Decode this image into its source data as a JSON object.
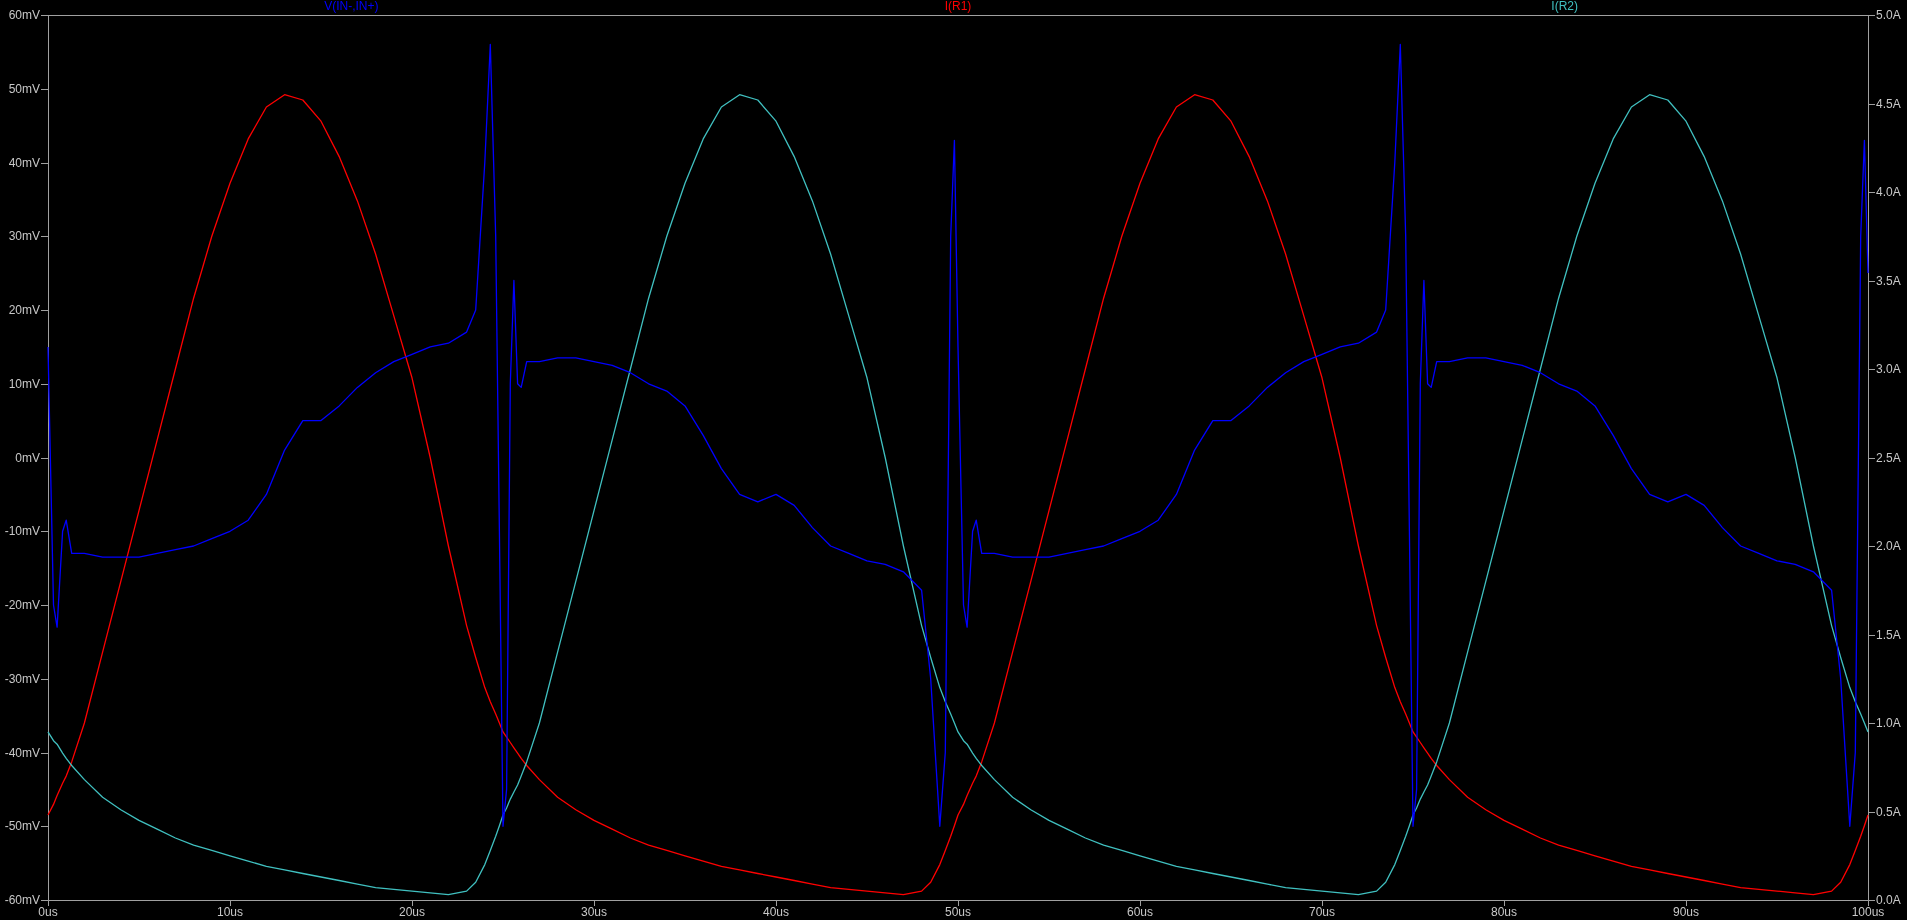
{
  "chart_data": {
    "type": "line",
    "x": [
      0,
      0.3,
      0.5,
      0.8,
      1,
      1.3,
      2,
      3,
      4,
      5,
      6,
      7,
      8,
      9,
      10,
      11,
      12,
      13,
      14,
      15,
      16,
      17,
      18,
      19,
      20,
      21,
      22,
      23,
      23.5,
      24,
      24.3,
      24.6,
      24.8,
      25,
      25.2,
      25.4,
      25.6,
      25.8,
      26,
      26.3,
      27,
      28,
      29,
      30,
      31,
      32,
      33,
      34,
      35,
      36,
      37,
      38,
      39,
      40,
      41,
      42,
      43,
      44,
      45,
      46,
      47,
      48,
      48.5,
      49,
      49.3,
      49.6,
      49.8,
      50,
      50.3,
      50.5,
      50.8,
      51,
      51.3,
      52,
      53,
      54,
      55,
      56,
      57,
      58,
      59,
      60,
      61,
      62,
      63,
      64,
      65,
      66,
      67,
      68,
      69,
      70,
      71,
      72,
      73,
      73.5,
      74,
      74.3,
      74.6,
      74.8,
      75,
      75.2,
      75.4,
      75.6,
      75.8,
      76,
      76.3,
      77,
      78,
      79,
      80,
      81,
      82,
      83,
      84,
      85,
      86,
      87,
      88,
      89,
      90,
      91,
      92,
      93,
      94,
      95,
      96,
      97,
      98,
      98.5,
      99,
      99.3,
      99.6,
      99.8,
      100
    ],
    "series": [
      {
        "name": "V(IN-,IN+)",
        "color": "#0000ff",
        "values": [
          15,
          -20,
          -23,
          -10,
          -8.5,
          -13,
          -13,
          -13.5,
          -13.5,
          -13.5,
          -13,
          -12.5,
          -12,
          -11,
          -10,
          -8.5,
          -5,
          1,
          5,
          5,
          7,
          9.5,
          11.5,
          13,
          14,
          15,
          15.5,
          17,
          20,
          40,
          56,
          30,
          -10,
          -50,
          -45,
          10,
          24,
          10,
          9.5,
          13,
          13,
          13.5,
          13.5,
          13,
          12.5,
          11.5,
          10,
          9,
          7,
          3,
          -1.5,
          -5,
          -6,
          -5,
          -6.5,
          -9.5,
          -12,
          -13,
          -14,
          -14.5,
          -15.5,
          -18,
          -30,
          -50,
          -40,
          30,
          43,
          15,
          -20,
          -23,
          -10,
          -8.5,
          -13,
          -13,
          -13.5,
          -13.5,
          -13.5,
          -13,
          -12.5,
          -12,
          -11,
          -10,
          -8.5,
          -5,
          1,
          5,
          5,
          7,
          9.5,
          11.5,
          13,
          14,
          15,
          15.5,
          17,
          20,
          40,
          56,
          30,
          -10,
          -50,
          -45,
          10,
          24,
          10,
          9.5,
          13,
          13,
          13.5,
          13.5,
          13,
          12.5,
          11.5,
          10,
          9,
          7,
          3,
          -1.5,
          -5,
          -6,
          -5,
          -6.5,
          -9.5,
          -12,
          -13,
          -14,
          -14.5,
          -15.5,
          -18,
          -30,
          -50,
          -40,
          30,
          43,
          25
        ]
      },
      {
        "name": "I(R1)",
        "color": "#ff0000",
        "axis": "y2",
        "values": [
          0.48,
          0.54,
          0.59,
          0.66,
          0.7,
          0.78,
          1.0,
          1.4,
          1.8,
          2.2,
          2.6,
          3.0,
          3.4,
          3.75,
          4.05,
          4.3,
          4.48,
          4.55,
          4.52,
          4.4,
          4.2,
          3.95,
          3.65,
          3.3,
          2.95,
          2.5,
          2.0,
          1.55,
          1.37,
          1.2,
          1.12,
          1.05,
          1.0,
          0.95,
          0.92,
          0.89,
          0.86,
          0.83,
          0.8,
          0.76,
          0.68,
          0.58,
          0.51,
          0.45,
          0.4,
          0.35,
          0.31,
          0.28,
          0.25,
          0.22,
          0.19,
          0.17,
          0.15,
          0.13,
          0.11,
          0.09,
          0.07,
          0.06,
          0.05,
          0.04,
          0.03,
          0.05,
          0.1,
          0.2,
          0.28,
          0.36,
          0.42,
          0.48,
          0.54,
          0.59,
          0.66,
          0.7,
          0.78,
          1.0,
          1.4,
          1.8,
          2.2,
          2.6,
          3.0,
          3.4,
          3.75,
          4.05,
          4.3,
          4.48,
          4.55,
          4.52,
          4.4,
          4.2,
          3.95,
          3.65,
          3.3,
          2.95,
          2.5,
          2.0,
          1.55,
          1.37,
          1.2,
          1.12,
          1.05,
          1.0,
          0.95,
          0.92,
          0.89,
          0.86,
          0.83,
          0.8,
          0.76,
          0.68,
          0.58,
          0.51,
          0.45,
          0.4,
          0.35,
          0.31,
          0.28,
          0.25,
          0.22,
          0.19,
          0.17,
          0.15,
          0.13,
          0.11,
          0.09,
          0.07,
          0.06,
          0.05,
          0.04,
          0.03,
          0.05,
          0.1,
          0.2,
          0.28,
          0.36,
          0.42,
          0.48
        ]
      },
      {
        "name": "I(R2)",
        "color": "#40c0c0",
        "axis": "y2",
        "values": [
          0.95,
          0.9,
          0.88,
          0.83,
          0.8,
          0.76,
          0.68,
          0.58,
          0.51,
          0.45,
          0.4,
          0.35,
          0.31,
          0.28,
          0.25,
          0.22,
          0.19,
          0.17,
          0.15,
          0.13,
          0.11,
          0.09,
          0.07,
          0.06,
          0.05,
          0.04,
          0.03,
          0.05,
          0.1,
          0.2,
          0.28,
          0.36,
          0.42,
          0.48,
          0.52,
          0.57,
          0.61,
          0.65,
          0.7,
          0.78,
          1.0,
          1.4,
          1.8,
          2.2,
          2.6,
          3.0,
          3.4,
          3.75,
          4.05,
          4.3,
          4.48,
          4.55,
          4.52,
          4.4,
          4.2,
          3.95,
          3.65,
          3.3,
          2.95,
          2.5,
          2.0,
          1.55,
          1.37,
          1.2,
          1.12,
          1.05,
          1.0,
          0.95,
          0.9,
          0.88,
          0.83,
          0.8,
          0.76,
          0.68,
          0.58,
          0.51,
          0.45,
          0.4,
          0.35,
          0.31,
          0.28,
          0.25,
          0.22,
          0.19,
          0.17,
          0.15,
          0.13,
          0.11,
          0.09,
          0.07,
          0.06,
          0.05,
          0.04,
          0.03,
          0.05,
          0.1,
          0.2,
          0.28,
          0.36,
          0.42,
          0.48,
          0.52,
          0.57,
          0.61,
          0.65,
          0.7,
          0.78,
          1.0,
          1.4,
          1.8,
          2.2,
          2.6,
          3.0,
          3.4,
          3.75,
          4.05,
          4.3,
          4.48,
          4.55,
          4.52,
          4.4,
          4.2,
          3.95,
          3.65,
          3.3,
          2.95,
          2.5,
          2.0,
          1.55,
          1.37,
          1.2,
          1.12,
          1.05,
          1.0,
          0.95
        ]
      }
    ],
    "xlim": [
      0,
      100
    ],
    "ylim": [
      -60,
      60
    ],
    "y2lim": [
      0,
      5
    ],
    "xticks": [
      {
        "value": 0,
        "label": "0us"
      },
      {
        "value": 10,
        "label": "10us"
      },
      {
        "value": 20,
        "label": "20us"
      },
      {
        "value": 30,
        "label": "30us"
      },
      {
        "value": 40,
        "label": "40us"
      },
      {
        "value": 50,
        "label": "50us"
      },
      {
        "value": 60,
        "label": "60us"
      },
      {
        "value": 70,
        "label": "70us"
      },
      {
        "value": 80,
        "label": "80us"
      },
      {
        "value": 90,
        "label": "90us"
      },
      {
        "value": 100,
        "label": "100us"
      }
    ],
    "yticks": [
      {
        "value": 60,
        "label": "60mV"
      },
      {
        "value": 50,
        "label": "50mV"
      },
      {
        "value": 40,
        "label": "40mV"
      },
      {
        "value": 30,
        "label": "30mV"
      },
      {
        "value": 20,
        "label": "20mV"
      },
      {
        "value": 10,
        "label": "10mV"
      },
      {
        "value": 0,
        "label": "0mV"
      },
      {
        "value": -10,
        "label": "-10mV"
      },
      {
        "value": -20,
        "label": "-20mV"
      },
      {
        "value": -30,
        "label": "-30mV"
      },
      {
        "value": -40,
        "label": "-40mV"
      },
      {
        "value": -50,
        "label": "-50mV"
      },
      {
        "value": -60,
        "label": "-60mV"
      }
    ],
    "y2ticks": [
      {
        "value": 5,
        "label": "5.0A"
      },
      {
        "value": 4.5,
        "label": "4.5A"
      },
      {
        "value": 4,
        "label": "4.0A"
      },
      {
        "value": 3.5,
        "label": "3.5A"
      },
      {
        "value": 3,
        "label": "3.0A"
      },
      {
        "value": 2.5,
        "label": "2.5A"
      },
      {
        "value": 2,
        "label": "2.0A"
      },
      {
        "value": 1.5,
        "label": "1.5A"
      },
      {
        "value": 1,
        "label": "1.0A"
      },
      {
        "value": 0.5,
        "label": "0.5A"
      },
      {
        "value": 0,
        "label": "0.0A"
      }
    ]
  }
}
